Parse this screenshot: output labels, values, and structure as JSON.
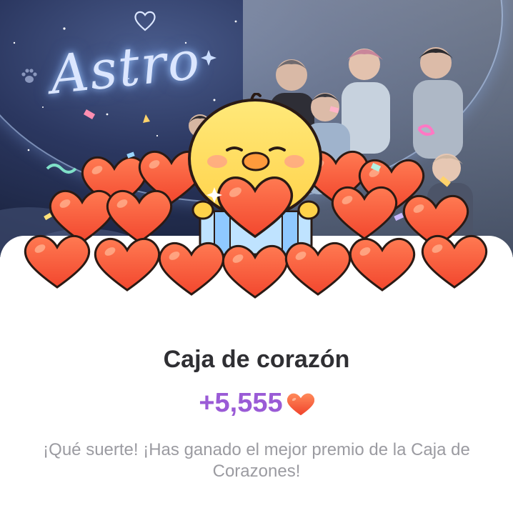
{
  "banner": {
    "logo_text": "Astro"
  },
  "reward": {
    "title": "Caja de corazón",
    "amount": "+5,555",
    "amount_icon": "heart-icon",
    "message": "¡Qué suerte! ¡Has ganado el mejor premio de la Caja de Corazones!"
  },
  "colors": {
    "amount": "#9a5bd6",
    "heart_fill": "#ff5a3c",
    "title": "#2f2f33",
    "message": "#9b9ba1"
  }
}
